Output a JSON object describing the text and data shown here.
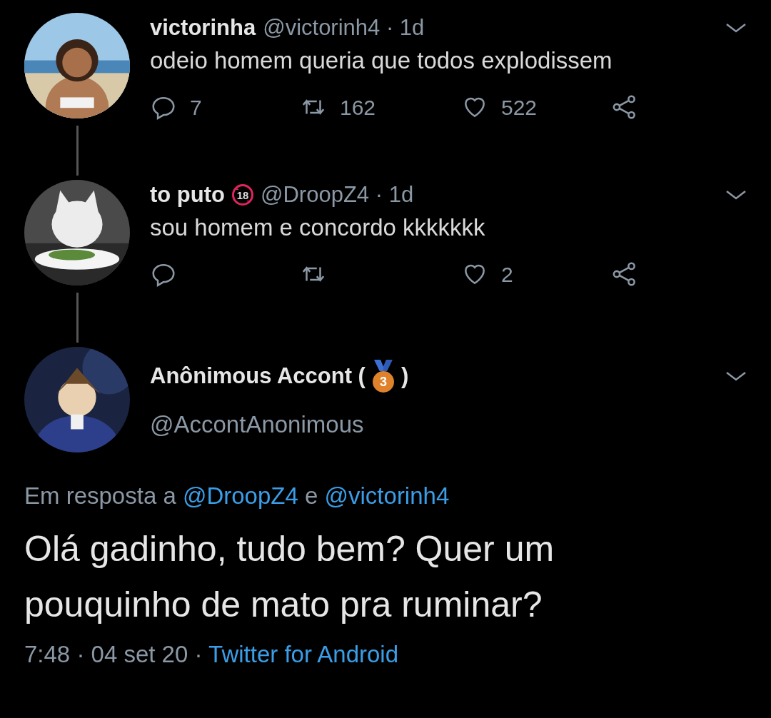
{
  "thread": [
    {
      "name": "victorinha",
      "handle": "@victorinh4",
      "sep": "·",
      "time": "1d",
      "text": "odeio homem queria que todos explodissem",
      "actions": {
        "reply": "7",
        "retweet": "162",
        "like": "522"
      }
    },
    {
      "name": "to puto",
      "badge": {
        "kind": "age",
        "label": "18"
      },
      "handle": "@DroopZ4",
      "sep": "·",
      "time": "1d",
      "text": "sou homem e concordo kkkkkkk",
      "actions": {
        "like": "2"
      }
    }
  ],
  "main": {
    "name": "Anônimous Accont (",
    "badge": {
      "kind": "medal",
      "label": "3"
    },
    "name_end": ")",
    "handle": "@AccontAnonimous",
    "reply_to": {
      "prefix": "Em resposta a",
      "mentions": [
        "@DroopZ4",
        "@victorinh4"
      ],
      "joiner": "e"
    },
    "text": "Olá gadinho, tudo bem? Quer um pouquinho de mato pra ruminar?",
    "time": "7:48",
    "sep": "·",
    "date": "04 set 20",
    "source": "Twitter for Android"
  }
}
